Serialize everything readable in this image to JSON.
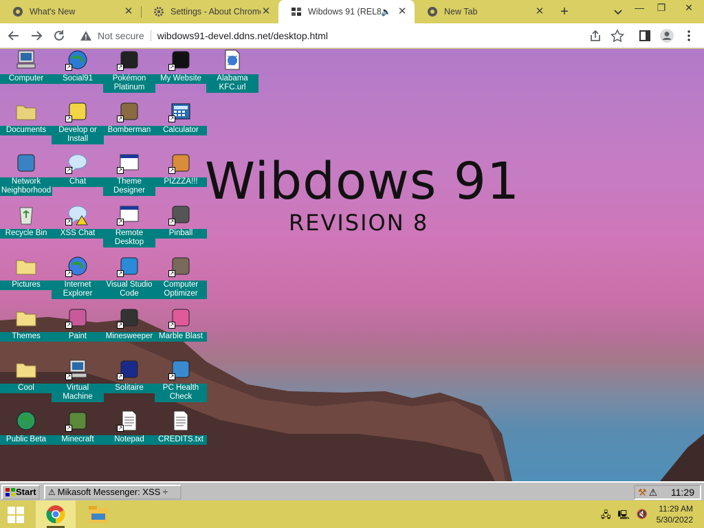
{
  "browser": {
    "tabs": [
      {
        "title": "What's New",
        "icon": "chrome-icon",
        "active": false
      },
      {
        "title": "Settings - About Chrome",
        "icon": "gear-icon",
        "active": false
      },
      {
        "title": "Wibdows 91 (REL8)",
        "icon": "wibdows-favicon",
        "active": true,
        "audio": true
      },
      {
        "title": "New Tab",
        "icon": "chrome-icon",
        "active": false
      }
    ],
    "new_tab_label": "+",
    "security_label": "Not secure",
    "url": "wibdows91-devel.ddns.net/desktop.html"
  },
  "desktop": {
    "logo_title": "Wibdows 91",
    "logo_subtitle": "REVISION 8",
    "icons": [
      {
        "label": "Computer",
        "icon": "computer-icon",
        "shortcut": false
      },
      {
        "label": "Social91",
        "icon": "globe-icon",
        "shortcut": true
      },
      {
        "label": "Pokémon Platinum",
        "icon": "pokemon-icon",
        "shortcut": true
      },
      {
        "label": "My Website",
        "icon": "github-icon",
        "shortcut": true
      },
      {
        "label": "Alabama KFC.url",
        "icon": "internet-shortcut-icon",
        "shortcut": false
      },
      {
        "label": "Documents",
        "icon": "documents-folder-icon",
        "shortcut": false
      },
      {
        "label": "Develop or Install",
        "icon": "help-icon",
        "shortcut": true
      },
      {
        "label": "Bomberman",
        "icon": "bomberman-icon",
        "shortcut": true
      },
      {
        "label": "Calculator",
        "icon": "calculator-icon",
        "shortcut": true
      },
      {
        "label": "Network Neighborhood",
        "icon": "network-icon",
        "shortcut": false
      },
      {
        "label": "Chat",
        "icon": "chat-bubble-icon",
        "shortcut": true
      },
      {
        "label": "Theme Designer",
        "icon": "window-icon",
        "shortcut": true
      },
      {
        "label": "PIZZZA!!!",
        "icon": "pizza-icon",
        "shortcut": true
      },
      {
        "label": "Recycle Bin",
        "icon": "recycle-bin-icon",
        "shortcut": false
      },
      {
        "label": "XSS Chat",
        "icon": "warning-chat-icon",
        "shortcut": true
      },
      {
        "label": "Remote Desktop",
        "icon": "remote-desktop-icon",
        "shortcut": true
      },
      {
        "label": "Pinball",
        "icon": "pinball-icon",
        "shortcut": true
      },
      {
        "label": "Pictures",
        "icon": "folder-icon",
        "shortcut": false
      },
      {
        "label": "Internet Explorer",
        "icon": "ie-icon",
        "shortcut": true
      },
      {
        "label": "Visual Studio Code",
        "icon": "vscode-icon",
        "shortcut": true
      },
      {
        "label": "Computer Optimizer",
        "icon": "gauge-icon",
        "shortcut": true
      },
      {
        "label": "Themes",
        "icon": "folder-icon",
        "shortcut": false
      },
      {
        "label": "Paint",
        "icon": "paint-icon",
        "shortcut": true
      },
      {
        "label": "Minesweeper",
        "icon": "mine-icon",
        "shortcut": true
      },
      {
        "label": "Marble Blast",
        "icon": "marble-icon",
        "shortcut": true
      },
      {
        "label": "Cool",
        "icon": "folder-icon",
        "shortcut": false
      },
      {
        "label": "Virtual Machine",
        "icon": "computer-icon",
        "shortcut": true
      },
      {
        "label": "Solitaire",
        "icon": "cards-icon",
        "shortcut": true
      },
      {
        "label": "PC Health Check",
        "icon": "health-check-icon",
        "shortcut": true
      },
      {
        "label": "Public Beta",
        "icon": "beta-globe-icon",
        "shortcut": false
      },
      {
        "label": "Minecraft",
        "icon": "minecraft-icon",
        "shortcut": true
      },
      {
        "label": "Notepad",
        "icon": "notepad-icon",
        "shortcut": true
      },
      {
        "label": "CREDITS.txt",
        "icon": "text-file-icon",
        "shortcut": false
      }
    ]
  },
  "w91_taskbar": {
    "start_label": "Start",
    "task_label": "Mikasoft Messenger: XSS ÷",
    "clock": "11:29"
  },
  "host_taskbar": {
    "apps": [
      "windows-start-icon",
      "chrome-icon",
      "file-explorer-icon"
    ],
    "time": "11:29 AM",
    "date": "5/30/2022"
  },
  "colors": {
    "icon_label_bg": "#008080",
    "tabstrip_bg": "#d9cf63",
    "w91_bar": "#c0c0c0"
  }
}
